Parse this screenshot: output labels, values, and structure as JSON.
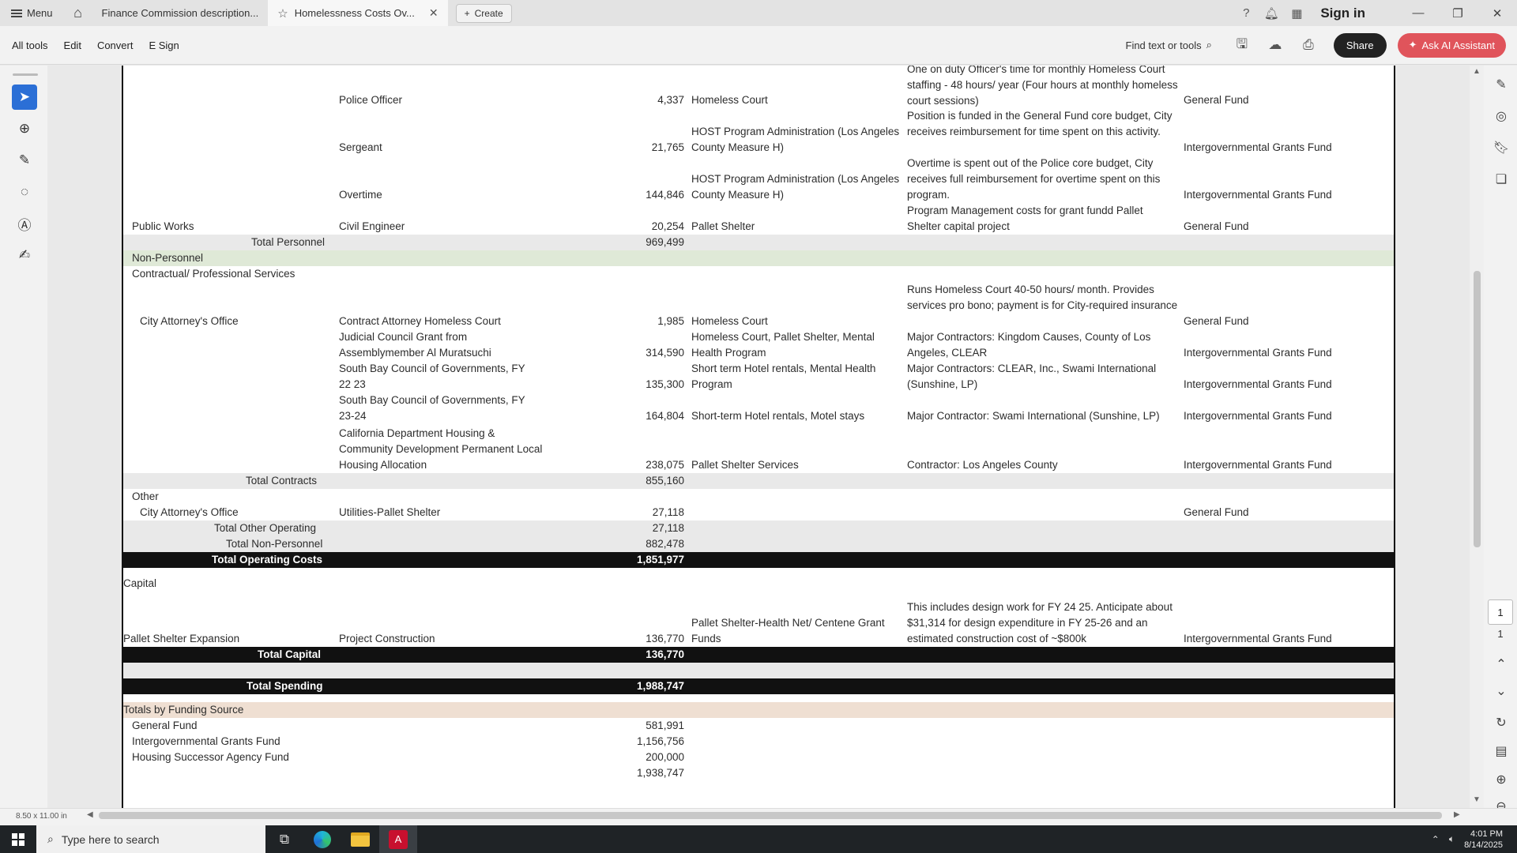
{
  "titlebar": {
    "menu_label": "Menu",
    "tabs": [
      {
        "label": "Finance Commission description..."
      },
      {
        "label": "Homelessness Costs Ov..."
      }
    ],
    "create_label": "Create",
    "signin_label": "Sign in"
  },
  "toolbar": {
    "items": [
      "All tools",
      "Edit",
      "Convert",
      "E Sign"
    ],
    "find_label": "Find text or tools",
    "share_label": "Share",
    "ai_label": "Ask AI Assistant"
  },
  "document": {
    "rows": [
      {
        "dept": "",
        "item": "Police Officer",
        "amount": "4,337",
        "program": "Homeless Court",
        "notes": "One on duty Officer's time for monthly Homeless Court staffing - 48 hours/ year (Four hours at monthly homeless court sessions)",
        "fund": "General Fund"
      },
      {
        "dept": "",
        "item": "Sergeant",
        "amount": "21,765",
        "program": "HOST Program Administration (Los Angeles County Measure H)",
        "notes": "Position is funded in the General Fund core budget, City receives reimbursement for time spent on this activity.",
        "fund": "Intergovernmental Grants Fund"
      },
      {
        "dept": "",
        "item": "Overtime",
        "amount": "144,846",
        "program": "HOST Program Administration (Los Angeles County Measure H)",
        "notes": "Overtime is spent out of the Police core budget, City receives full reimbursement for overtime spent on this program.",
        "fund": "Intergovernmental Grants Fund"
      },
      {
        "dept": "Public Works",
        "item": "Civil Engineer",
        "amount": "20,254",
        "program": "Pallet Shelter",
        "notes": "Program Management costs for grant fundd Pallet Shelter capital project",
        "fund": "General Fund"
      }
    ],
    "total_personnel": {
      "label": "Total Personnel",
      "amount": "969,499"
    },
    "non_personnel_label": "Non-Personnel",
    "contractual_label": "Contractual/ Professional Services",
    "contract_rows": [
      {
        "dept": "City Attorney's Office",
        "item": "Contract Attorney Homeless Court",
        "amount": "1,985",
        "program": "Homeless Court",
        "notes": "Runs Homeless Court 40-50 hours/ month. Provides services pro bono; payment is for City-required insurance",
        "fund": "General Fund"
      },
      {
        "dept": "",
        "item": "Judicial Council Grant from Assemblymember Al Muratsuchi",
        "amount": "314,590",
        "program": "Homeless Court, Pallet Shelter, Mental Health Program",
        "notes": "Major Contractors: Kingdom Causes, County of Los Angeles, CLEAR",
        "fund": "Intergovernmental Grants Fund"
      },
      {
        "dept": "",
        "item": "South Bay Council of Governments, FY 22 23",
        "amount": "135,300",
        "program": "Short term Hotel rentals, Mental Health Program",
        "notes": "Major Contractors: CLEAR, Inc., Swami International (Sunshine, LP)",
        "fund": "Intergovernmental Grants Fund"
      },
      {
        "dept": "",
        "item": "South Bay Council of Governments, FY 23-24",
        "amount": "164,804",
        "program": "Short-term Hotel rentals, Motel stays",
        "notes": "Major Contractor: Swami International (Sunshine, LP)",
        "fund": "Intergovernmental Grants Fund"
      },
      {
        "dept": "",
        "item": "California Department Housing & Community Development Permanent Local Housing Allocation",
        "amount": "238,075",
        "program": "Pallet Shelter Services",
        "notes": "Contractor: Los Angeles County",
        "fund": "Intergovernmental Grants Fund"
      }
    ],
    "total_contracts": {
      "label": "Total Contracts",
      "amount": "855,160"
    },
    "other_label": "Other",
    "other_row": {
      "dept": "City Attorney's Office",
      "item": "Utilities-Pallet Shelter",
      "amount": "27,118",
      "fund": "General Fund"
    },
    "total_other_operating": {
      "label": "Total Other Operating",
      "amount": "27,118"
    },
    "total_non_personnel": {
      "label": "Total Non-Personnel",
      "amount": "882,478"
    },
    "total_operating": {
      "label": "Total Operating Costs",
      "amount": "1,851,977"
    },
    "capital_label": "Capital",
    "capital_row": {
      "dept": "Pallet Shelter Expansion",
      "item": "Project Construction",
      "amount": "136,770",
      "program": "Pallet Shelter-Health Net/ Centene Grant Funds",
      "notes": "This includes design work for FY 24 25. Anticipate about $31,314 for design expenditure in FY 25-26 and an estimated construction cost of ~$800k",
      "fund": "Intergovernmental Grants Fund"
    },
    "total_capital": {
      "label": "Total Capital",
      "amount": "136,770"
    },
    "total_spending": {
      "label": "Total Spending",
      "amount": "1,988,747"
    },
    "funding_label": "Totals by Funding Source",
    "funding_rows": [
      {
        "label": "General Fund",
        "amount": "581,991"
      },
      {
        "label": "Intergovernmental Grants Fund",
        "amount": "1,156,756"
      },
      {
        "label": "Housing Successor Agency Fund",
        "amount": "200,000"
      },
      {
        "label": "",
        "amount": "1,938,747"
      }
    ]
  },
  "viewer": {
    "page_current": "1",
    "page_total": "1",
    "page_size": "8.50 x 11.00 in"
  },
  "taskbar": {
    "search_placeholder": "Type here to search",
    "time": "4:01 PM",
    "date": "8/14/2025"
  },
  "colors": {
    "accent": "#2b6fd6",
    "ai_button": "#e0545b",
    "non_personnel_band": "#dfe9d7",
    "funding_band": "#efdfd2"
  }
}
